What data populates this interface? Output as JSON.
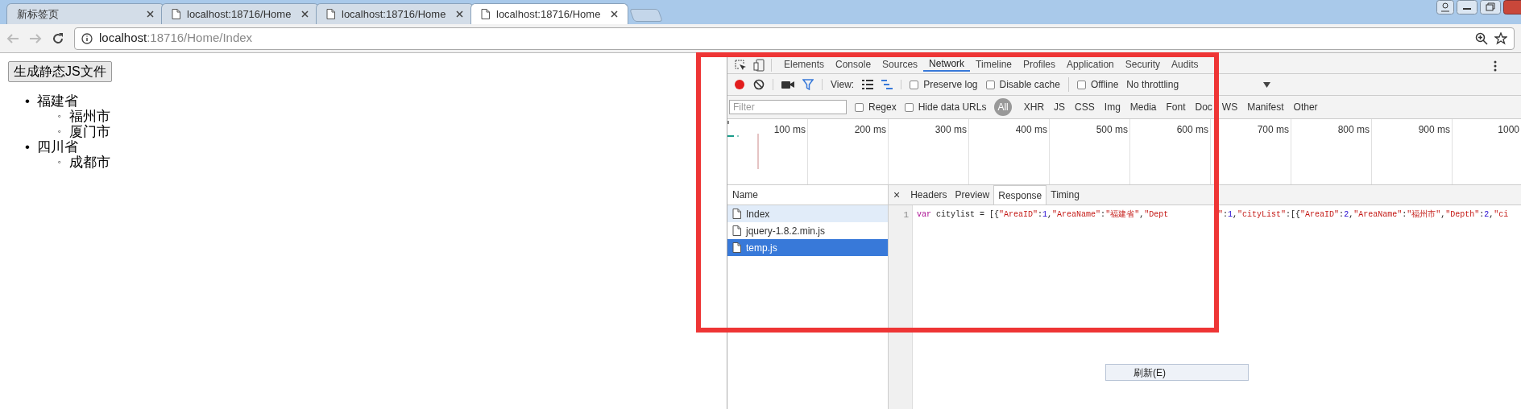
{
  "browser": {
    "tabs": [
      {
        "title": "新标签页",
        "icon": false,
        "selected": false
      },
      {
        "title": "localhost:18716/Home",
        "icon": true,
        "selected": false
      },
      {
        "title": "localhost:18716/Home",
        "icon": true,
        "selected": false
      },
      {
        "title": "localhost:18716/Home",
        "icon": true,
        "selected": true
      }
    ],
    "address": {
      "host": "localhost",
      "path": ":18716/Home/Index"
    }
  },
  "page": {
    "button": "生成静态JS文件",
    "list": [
      {
        "marker": "•",
        "text": "福建省",
        "children": [
          {
            "marker": "◦",
            "text": "福州市"
          },
          {
            "marker": "◦",
            "text": "厦门市"
          }
        ]
      },
      {
        "marker": "•",
        "text": "四川省",
        "children": [
          {
            "marker": "◦",
            "text": "成都市"
          }
        ]
      }
    ]
  },
  "devtools": {
    "panels": [
      {
        "label": "Elements",
        "selected": false
      },
      {
        "label": "Console",
        "selected": false
      },
      {
        "label": "Sources",
        "selected": false
      },
      {
        "label": "Network",
        "selected": true
      },
      {
        "label": "Timeline",
        "selected": false
      },
      {
        "label": "Profiles",
        "selected": false
      },
      {
        "label": "Application",
        "selected": false
      },
      {
        "label": "Security",
        "selected": false
      },
      {
        "label": "Audits",
        "selected": false
      }
    ],
    "recording": true,
    "view_label": "View:",
    "options": [
      {
        "label": "Preserve log",
        "checked": false
      },
      {
        "label": "Disable cache",
        "checked": false
      },
      {
        "label": "Offline",
        "checked": false
      }
    ],
    "throttling": "No throttling",
    "filter": {
      "placeholder": "Filter"
    },
    "filter_options": [
      {
        "label": "Regex",
        "checked": false
      },
      {
        "label": "Hide data URLs",
        "checked": false
      }
    ],
    "types": [
      {
        "label": "All",
        "selected": true
      },
      {
        "label": "XHR",
        "selected": false
      },
      {
        "label": "JS",
        "selected": false
      },
      {
        "label": "CSS",
        "selected": false
      },
      {
        "label": "Img",
        "selected": false
      },
      {
        "label": "Media",
        "selected": false
      },
      {
        "label": "Font",
        "selected": false
      },
      {
        "label": "Doc",
        "selected": false
      },
      {
        "label": "WS",
        "selected": false
      },
      {
        "label": "Manifest",
        "selected": false
      },
      {
        "label": "Other",
        "selected": false
      }
    ],
    "timeline_ticks": [
      "100 ms",
      "200 ms",
      "300 ms",
      "400 ms",
      "500 ms",
      "600 ms",
      "700 ms",
      "800 ms",
      "900 ms",
      "1000"
    ],
    "name_header": "Name",
    "requests": [
      {
        "name": "Index",
        "selected": false,
        "hovered": true
      },
      {
        "name": "jquery-1.8.2.min.js",
        "selected": false,
        "hovered": false
      },
      {
        "name": "temp.js",
        "selected": true,
        "hovered": false
      }
    ],
    "close_symbol": "×",
    "detail_tabs": [
      {
        "label": "Headers",
        "selected": false
      },
      {
        "label": "Preview",
        "selected": false
      },
      {
        "label": "Response",
        "selected": true
      },
      {
        "label": "Timing",
        "selected": false
      }
    ],
    "code_lines": [
      {
        "number": "1",
        "tokens": [
          {
            "kind": "keyword",
            "text": "var"
          },
          {
            "kind": "plain",
            "text": " citylist = [{"
          },
          {
            "kind": "string",
            "text": "\"AreaID\""
          },
          {
            "kind": "plain",
            "text": ":"
          },
          {
            "kind": "number",
            "text": "1"
          },
          {
            "kind": "plain",
            "text": ","
          },
          {
            "kind": "string",
            "text": "\"AreaName\""
          },
          {
            "kind": "plain",
            "text": ":"
          },
          {
            "kind": "string",
            "text": "\"福建省\""
          },
          {
            "kind": "plain",
            "text": ","
          },
          {
            "kind": "string",
            "text": "\"Dept"
          }
        ],
        "tokens_after_cover": [
          {
            "kind": "string",
            "text": "\""
          },
          {
            "kind": "plain",
            "text": ":"
          },
          {
            "kind": "number",
            "text": "1"
          },
          {
            "kind": "plain",
            "text": ","
          },
          {
            "kind": "string",
            "text": "\"cityList\""
          },
          {
            "kind": "plain",
            "text": ":[{"
          },
          {
            "kind": "string",
            "text": "\"AreaID\""
          },
          {
            "kind": "plain",
            "text": ":"
          },
          {
            "kind": "number",
            "text": "2"
          },
          {
            "kind": "plain",
            "text": ","
          },
          {
            "kind": "string",
            "text": "\"AreaName\""
          },
          {
            "kind": "plain",
            "text": ":"
          },
          {
            "kind": "string",
            "text": "\"福州市\""
          },
          {
            "kind": "plain",
            "text": ","
          },
          {
            "kind": "string",
            "text": "\"Depth\""
          },
          {
            "kind": "plain",
            "text": ":"
          },
          {
            "kind": "number",
            "text": "2"
          },
          {
            "kind": "plain",
            "text": ","
          },
          {
            "kind": "string",
            "text": "\"ci"
          }
        ]
      }
    ]
  },
  "context_menu": {
    "item": "刷新(E)"
  }
}
